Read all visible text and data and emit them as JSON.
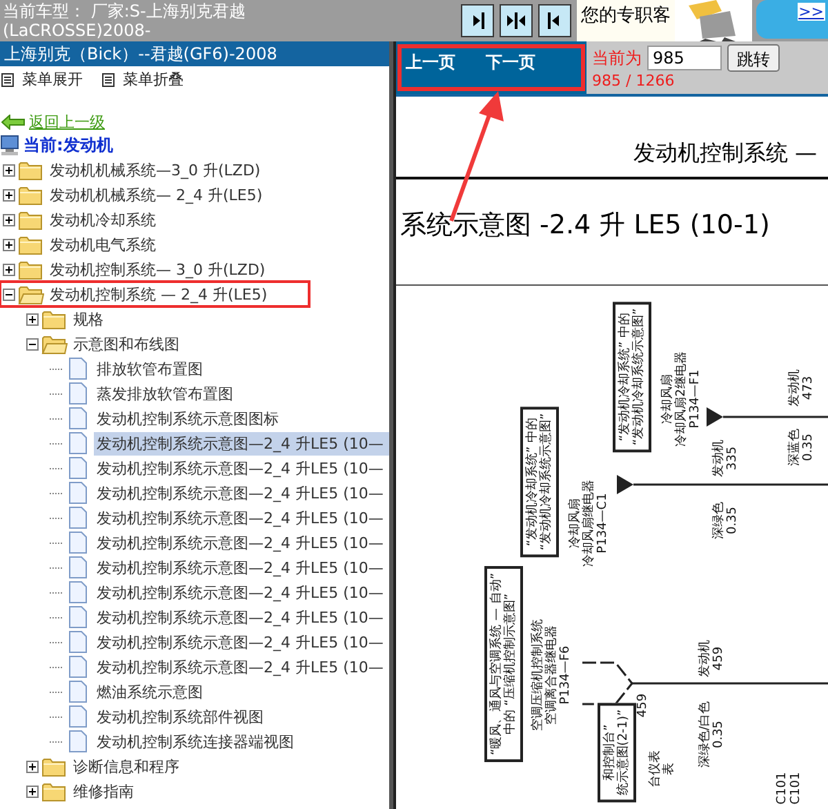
{
  "top_bar": {
    "vehicle_lines": [
      "当前车型： 厂家:S-上海别克君越",
      "(LaCROSSE)2008-"
    ],
    "promo_text": "您的专职客",
    "promo_link": ">>"
  },
  "sidebar": {
    "title": "上海别克（Bick）--君越(GF6)-2008",
    "menu_actions": [
      "菜单展开",
      "菜单折叠"
    ],
    "back_link": "返回上一级",
    "current": "当前:发动机",
    "tree": [
      {
        "label": "发动机机械系统—3_0 升(LZD)",
        "kind": "folder",
        "expanded": false,
        "selected": false,
        "outlined": false
      },
      {
        "label": "发动机机械系统— 2_4 升(LE5)",
        "kind": "folder",
        "expanded": false,
        "selected": false,
        "outlined": false
      },
      {
        "label": "发动机冷却系统",
        "kind": "folder",
        "expanded": false,
        "selected": false,
        "outlined": false
      },
      {
        "label": "发动机电气系统",
        "kind": "folder",
        "expanded": false,
        "selected": false,
        "outlined": false
      },
      {
        "label": "发动机控制系统— 3_0 升(LZD)",
        "kind": "folder",
        "expanded": false,
        "selected": false,
        "outlined": false
      },
      {
        "label": "发动机控制系统 — 2_4 升(LE5)",
        "kind": "folder",
        "expanded": true,
        "selected": false,
        "outlined": true,
        "children": [
          {
            "label": "规格",
            "kind": "folder",
            "expanded": false,
            "selected": false
          },
          {
            "label": "示意图和布线图",
            "kind": "folder",
            "expanded": true,
            "selected": false,
            "children": [
              {
                "label": "排放软管布置图",
                "kind": "doc",
                "selected": false
              },
              {
                "label": "蒸发排放软管布置图",
                "kind": "doc",
                "selected": false
              },
              {
                "label": "发动机控制系统示意图图标",
                "kind": "doc",
                "selected": false
              },
              {
                "label": "发动机控制系统示意图—2_4 升LE5 (10—",
                "kind": "doc",
                "selected": true
              },
              {
                "label": "发动机控制系统示意图—2_4 升LE5 (10—",
                "kind": "doc",
                "selected": false
              },
              {
                "label": "发动机控制系统示意图—2_4 升LE5 (10—",
                "kind": "doc",
                "selected": false
              },
              {
                "label": "发动机控制系统示意图—2_4 升LE5 (10—",
                "kind": "doc",
                "selected": false
              },
              {
                "label": "发动机控制系统示意图—2_4 升LE5 (10—",
                "kind": "doc",
                "selected": false
              },
              {
                "label": "发动机控制系统示意图—2_4 升LE5 (10—",
                "kind": "doc",
                "selected": false
              },
              {
                "label": "发动机控制系统示意图—2_4 升LE5 (10—",
                "kind": "doc",
                "selected": false
              },
              {
                "label": "发动机控制系统示意图—2_4 升LE5 (10—",
                "kind": "doc",
                "selected": false
              },
              {
                "label": "发动机控制系统示意图—2_4 升LE5 (10—",
                "kind": "doc",
                "selected": false
              },
              {
                "label": "发动机控制系统示意图—2_4 升LE5 (10—",
                "kind": "doc",
                "selected": false
              },
              {
                "label": "燃油系统示意图",
                "kind": "doc",
                "selected": false
              },
              {
                "label": "发动机控制系统部件视图",
                "kind": "doc",
                "selected": false
              },
              {
                "label": "发动机控制系统连接器端视图",
                "kind": "doc",
                "selected": false
              }
            ]
          },
          {
            "label": "诊断信息和程序",
            "kind": "folder",
            "expanded": false,
            "selected": false
          },
          {
            "label": "维修指南",
            "kind": "folder",
            "expanded": false,
            "selected": false
          }
        ]
      }
    ]
  },
  "viewer": {
    "nav": {
      "prev": "上一页",
      "next": "下一页",
      "outlined": true
    },
    "page_label": "当前为",
    "page_input": "985",
    "jump_button": "跳转",
    "page_count": "985 / 1266",
    "doc_title": "发动机控制系统 —",
    "doc_subtitle": "系统示意图 -2.4 升 LE5 (10-1)",
    "diagram": {
      "callouts": [
        "“发动机冷却系统” 中的\n“发动机冷却系统示意图”",
        "“发动机冷却系统” 中的\n“发动机冷却系统示意图”",
        "“暖风、通风与空调系统 — 自动”\n中的 “压缩机控制示意图”",
        "和控制台”\n统示意图(2-1)”"
      ],
      "components": [
        [
          "冷却风扇",
          "冷却风扇继电器",
          "P134—C1"
        ],
        [
          "冷却风扇",
          "冷却风扇2继电器",
          "P134—F1"
        ],
        [
          "空调压缩机控制系统",
          "空调离合器继电器",
          "P134—F6"
        ],
        [
          "台仪表",
          "表"
        ]
      ],
      "wires": [
        {
          "kind": "arrow",
          "top_label": "发动机\n335",
          "bottom_label": "深绿色\n0.35"
        },
        {
          "kind": "arrow",
          "top_label": "发动机\n473",
          "bottom_label": "深蓝色\n0.35"
        },
        {
          "kind": "connector",
          "pin": "459",
          "top_label": "发动机\n459",
          "bottom_label": "深绿色/白色\n0.35"
        }
      ],
      "connector_refs": [
        "C101\nC101"
      ]
    }
  }
}
